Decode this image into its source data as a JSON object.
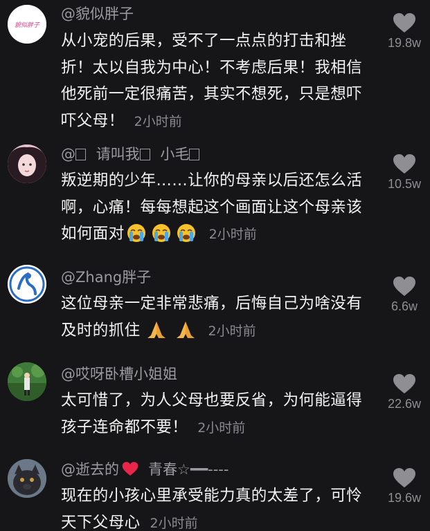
{
  "comments": [
    {
      "username": "@貌似胖子",
      "text": "从小宠的后果，受不了一点点的打击和挫折！太以自我为中心！不考虑后果！我相信他死前一定很痛苦，其实不想死，只是想吓吓父母！",
      "time": "2小时前",
      "likes": "19.8w",
      "avatar_text": "貌似胖子"
    },
    {
      "username_parts": [
        "@",
        "请叫我",
        "小毛"
      ],
      "text": "叛逆期的少年……让你的母亲以后还怎么活啊，心痛！每每想起这个画面让这个母亲该如何面对",
      "time": "2小时前",
      "likes": "10.5w"
    },
    {
      "username": "@Zhang胖子",
      "text": "这位母亲一定非常悲痛，后悔自己为啥没有及时的抓住",
      "time": "2小时前",
      "likes": "6.6w"
    },
    {
      "username": "@哎呀卧槽小姐姐",
      "text": "太可惜了，为人父母也要反省，为何能逼得孩子连命都不要！",
      "time": "2小时前",
      "likes": "22.6w"
    },
    {
      "username_parts": [
        "@逝去的",
        "青春☆━━----"
      ],
      "text": "现在的小孩心里承受能力真的太差了，可怜天下父母心",
      "time": "2小时前",
      "likes": "19.6w"
    }
  ],
  "colors": {
    "background": "#161618",
    "text": "#f2f2f2",
    "secondary": "#9a9aa0",
    "heart": "#8e8e93",
    "red_heart": "#e8264a"
  },
  "icons": [
    "heart-icon",
    "crying-emoji",
    "praying-hands-emoji",
    "red-heart-emoji"
  ]
}
